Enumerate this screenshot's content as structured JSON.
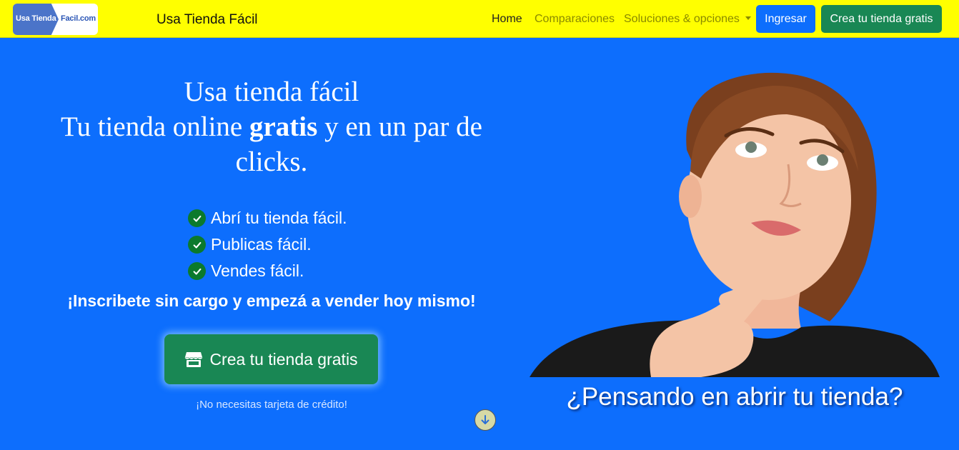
{
  "navbar": {
    "logo": {
      "line1": "Usa Tienda",
      "line2": "Facil.com"
    },
    "brand": "Usa Tienda Fácil",
    "links": {
      "home": "Home",
      "comparaciones": "Comparaciones",
      "soluciones": "Soluciones & opciones"
    },
    "login_button": "Ingresar",
    "create_button": "Crea tu tienda gratis"
  },
  "hero": {
    "title_line1": "Usa tienda fácil",
    "title_line2_pre": "Tu tienda online ",
    "title_line2_bold": "gratis",
    "title_line2_post": " y en un par de",
    "title_line3": "clicks.",
    "features": [
      "Abrí tu tienda fácil.",
      "Publicas fácil.",
      "Vendes fácil."
    ],
    "subcta": "¡Inscribete sin cargo y empezá a vender hoy mismo!",
    "main_button": "Crea tu tienda gratis",
    "note": "¡No necesitas tarjeta de crédito!",
    "question": "¿Pensando en abrir tu tienda?"
  },
  "icons": {
    "feature": "check-circle-icon",
    "main_button": "store-icon",
    "scroll": "arrow-down-icon",
    "nav_dropdown": "caret-down-icon"
  },
  "colors": {
    "navbar_bg": "#ffff00",
    "hero_bg": "#0d6efd",
    "primary": "#0d6efd",
    "success": "#198754",
    "check": "#0b7a2c"
  }
}
